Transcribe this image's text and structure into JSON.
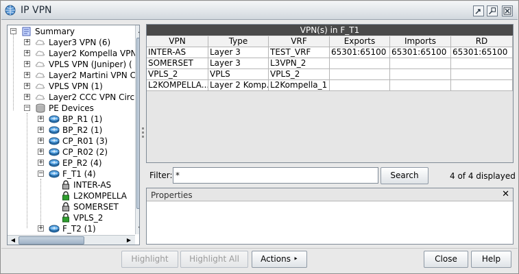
{
  "window": {
    "title": "IP VPN",
    "icons": [
      "globe-icon",
      "restore-icon",
      "maximize-icon",
      "close-icon"
    ]
  },
  "tree": {
    "root": "Summary",
    "items": [
      {
        "label": "Layer3 VPN (6)",
        "icon": "vpn-icon"
      },
      {
        "label": "Layer2 Kompella VPN",
        "icon": "vpn-icon"
      },
      {
        "label": "VPLS VPN (Juniper) (",
        "icon": "vpn-icon"
      },
      {
        "label": "Layer2 Martini VPN C",
        "icon": "vpn-icon"
      },
      {
        "label": "VPLS VPN (1)",
        "icon": "vpn-icon"
      },
      {
        "label": "Layer2 CCC VPN Circ",
        "icon": "vpn-icon"
      }
    ],
    "pe_devices": "PE Devices",
    "routers": [
      {
        "label": "BP_R1 (1)"
      },
      {
        "label": "BP_R2 (1)"
      },
      {
        "label": "CP_R01 (3)"
      },
      {
        "label": "CP_R02 (2)"
      },
      {
        "label": "EP_R2 (4)"
      },
      {
        "label": "F_T1 (4)"
      }
    ],
    "f_t1_children": [
      {
        "label": "INTER-AS",
        "lock": "gray"
      },
      {
        "label": "L2KOMPELLA",
        "lock": "green"
      },
      {
        "label": "SOMERSET",
        "lock": "gray"
      },
      {
        "label": "VPLS_2",
        "lock": "green"
      }
    ],
    "last": "F_T2 (1)"
  },
  "vpn_table": {
    "title": "VPN(s) in F_T1",
    "columns": [
      "VPN",
      "Type",
      "VRF",
      "Exports",
      "Imports",
      "RD"
    ],
    "rows": [
      [
        "INTER-AS",
        "Layer 3",
        "TEST_VRF",
        "65301:65100",
        "65301:65100",
        "65301:65100"
      ],
      [
        "SOMERSET",
        "Layer 3",
        "L3VPN_2",
        "",
        "",
        ""
      ],
      [
        "VPLS_2",
        "VPLS",
        "VPLS_2",
        "",
        "",
        ""
      ],
      [
        "L2KOMPELLA...",
        "Layer 2 Komp...",
        "L2Kompella_1",
        "",
        "",
        ""
      ]
    ]
  },
  "filter": {
    "label": "Filter:",
    "value": "*",
    "search_label": "Search",
    "count": "4 of 4 displayed"
  },
  "properties": {
    "title": "Properties",
    "close": "✕"
  },
  "buttons": {
    "highlight": "Highlight",
    "highlight_all": "Highlight All",
    "actions": "Actions ‣",
    "close": "Close",
    "help": "Help"
  },
  "colors": {
    "header_dark": "#4a4a4a",
    "lock_green": "#2e9e2e",
    "router_blue": "#2f7fc2"
  }
}
